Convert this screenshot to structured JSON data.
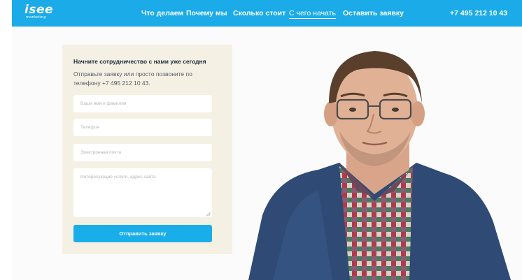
{
  "header": {
    "logo": {
      "main": "isee",
      "sub": "marketing"
    },
    "nav": [
      {
        "label": "Что делаем"
      },
      {
        "label": "Почему мы"
      },
      {
        "label": "Сколько стоит"
      },
      {
        "label": "С чего начать",
        "active": true
      },
      {
        "label": "Оставить заявку"
      }
    ],
    "phone": "+7 495 212 10 43"
  },
  "form": {
    "title": "Начните сотрудничество с нами уже сегодня",
    "description": "Отправьте заявку или просто позвоните по телефону +7 495 212 10 43.",
    "fields": {
      "name_placeholder": "Ваши имя и фамилия",
      "phone_placeholder": "Телефон",
      "email_placeholder": "Электронная почта",
      "message_placeholder": "Интересующие услуги, адрес сайта"
    },
    "submit_label": "Отправить заявку"
  },
  "photo": {
    "icon": "person-photo"
  },
  "colors": {
    "brand": "#1aabe8",
    "button": "#19aee9",
    "card": "#f4f1e4",
    "title": "#1f2a3a"
  }
}
